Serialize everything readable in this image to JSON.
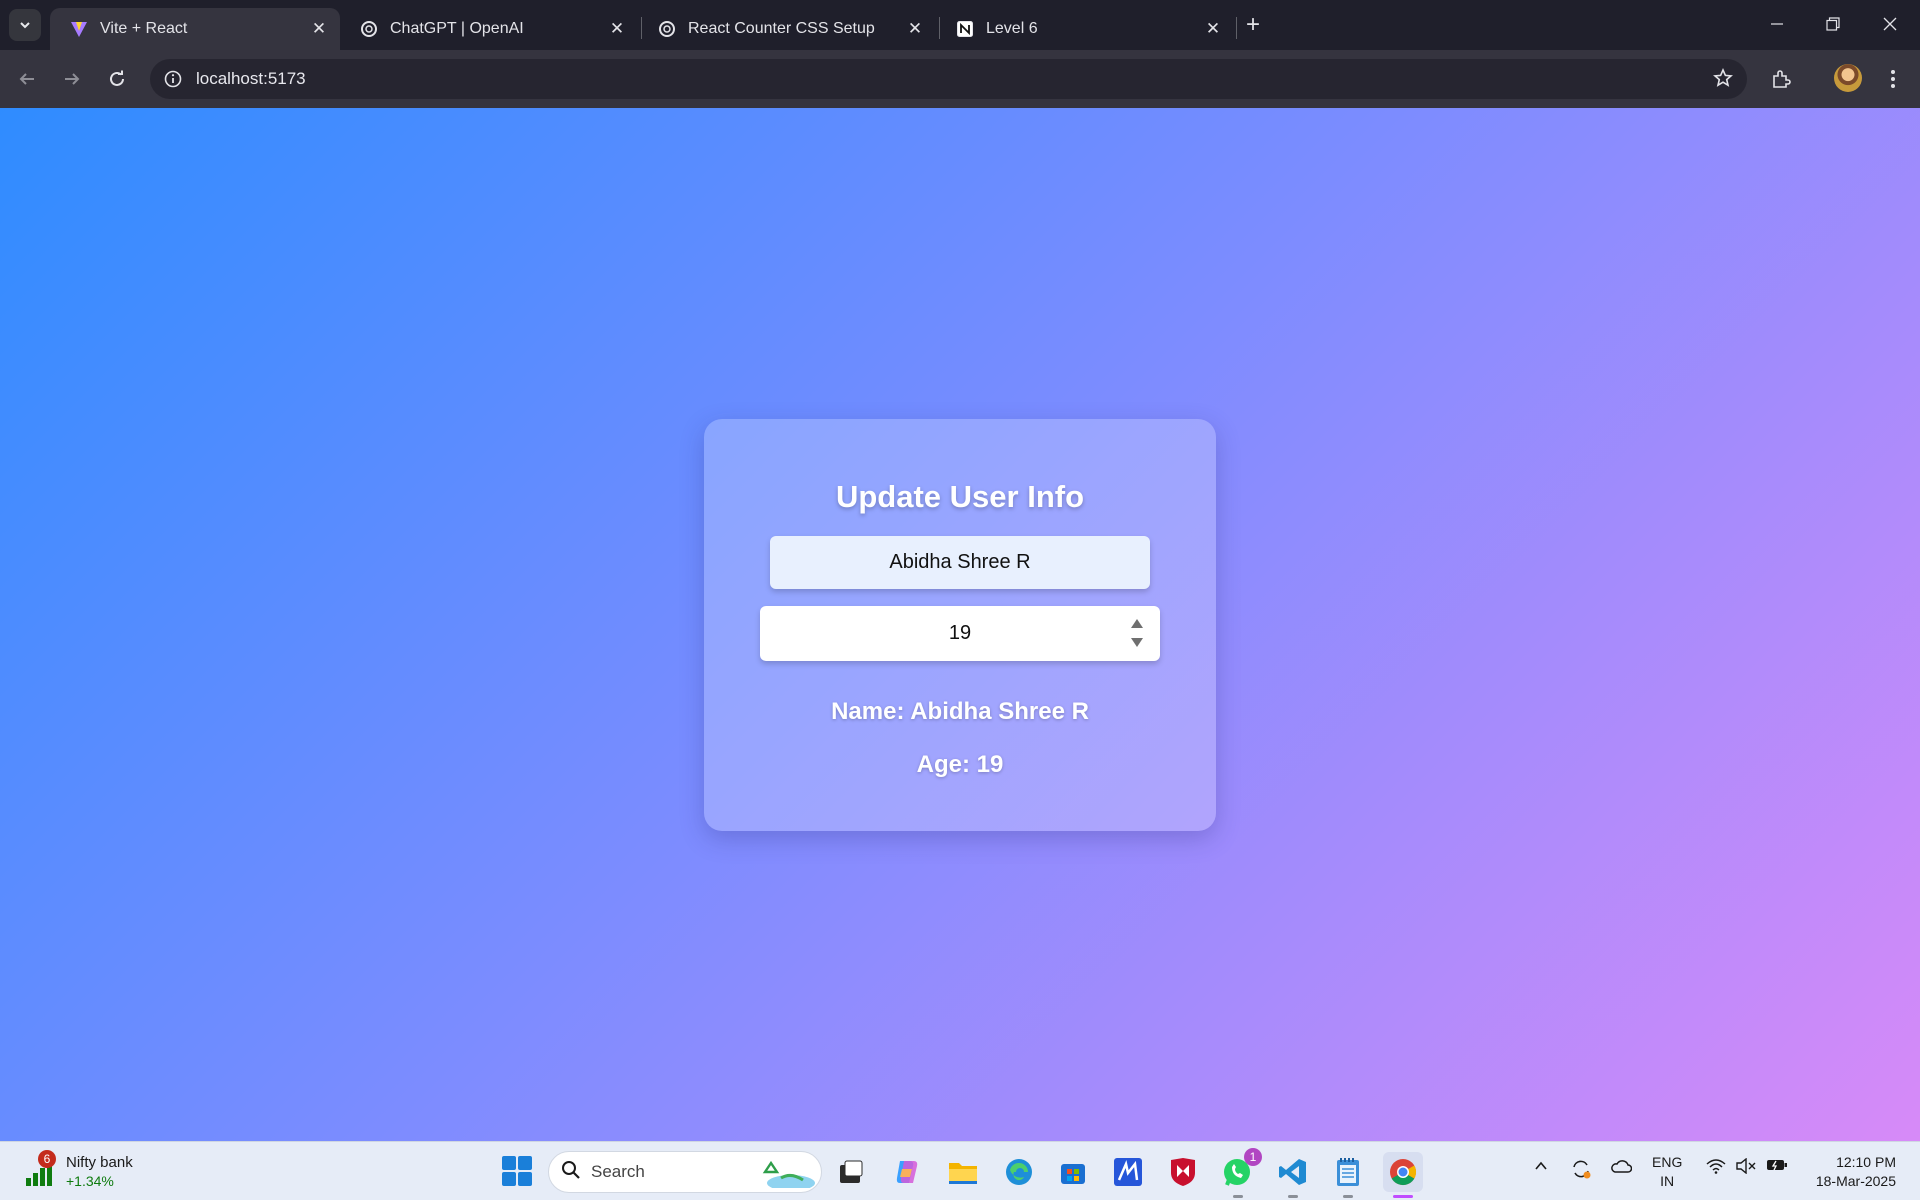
{
  "browser": {
    "tabs": [
      {
        "title": "Vite + React",
        "favicon": "vite-icon",
        "active": true
      },
      {
        "title": "ChatGPT | OpenAI",
        "favicon": "openai-icon",
        "active": false
      },
      {
        "title": "React Counter CSS Setup",
        "favicon": "openai-icon",
        "active": false
      },
      {
        "title": "Level 6",
        "favicon": "notion-icon",
        "active": false
      }
    ],
    "close_glyph": "✕",
    "new_tab_glyph": "+",
    "url": "localhost:5173"
  },
  "card": {
    "title": "Update User Info",
    "name_value": "Abidha Shree R",
    "age_value": "19",
    "name_line": "Name: Abidha Shree R",
    "age_line": "Age: 19"
  },
  "taskbar": {
    "widget": {
      "badge": "6",
      "title": "Nifty bank",
      "value": "+1.34%"
    },
    "search_placeholder": "Search",
    "whatsapp_badge": "1",
    "lang_line1": "ENG",
    "lang_line2": "IN",
    "time": "12:10 PM",
    "date": "18-Mar-2025"
  },
  "colors": {
    "accent_gradient_start": "#2f8cff",
    "accent_gradient_end": "#d78af8",
    "widget_positive": "#0f7b0f"
  }
}
